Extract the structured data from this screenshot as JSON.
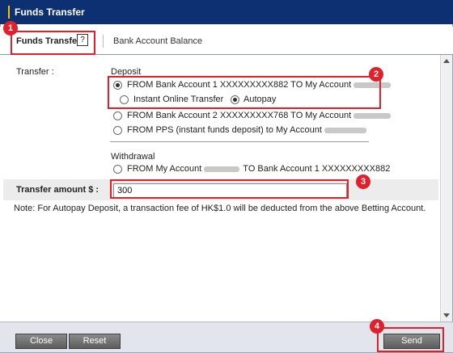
{
  "window": {
    "title": "Funds Transfer"
  },
  "tabs": {
    "active": "Funds Transfer",
    "help_icon": "?",
    "second": "Bank Account Balance"
  },
  "form": {
    "transfer_label": "Transfer :",
    "deposit_header": "Deposit",
    "withdrawal_header": "Withdrawal",
    "options": {
      "from_bank1": "FROM Bank Account 1 XXXXXXXXX882 TO My Account",
      "instant_online": "Instant Online Transfer",
      "autopay": "Autopay",
      "from_bank2": "FROM Bank Account 2 XXXXXXXXX768 TO My Account",
      "from_pps": "FROM PPS (instant funds deposit) to My Account",
      "withdraw_from": "FROM My Account",
      "withdraw_to": "TO Bank Account 1 XXXXXXXXX882"
    },
    "amount_label": "Transfer amount $ :",
    "amount_value": "300",
    "note": "Note: For Autopay Deposit, a transaction fee of HK$1.0 will be deducted from the above Betting Account."
  },
  "buttons": {
    "close": "Close",
    "reset": "Reset",
    "send": "Send"
  },
  "annotations": [
    "1",
    "2",
    "3",
    "4"
  ]
}
